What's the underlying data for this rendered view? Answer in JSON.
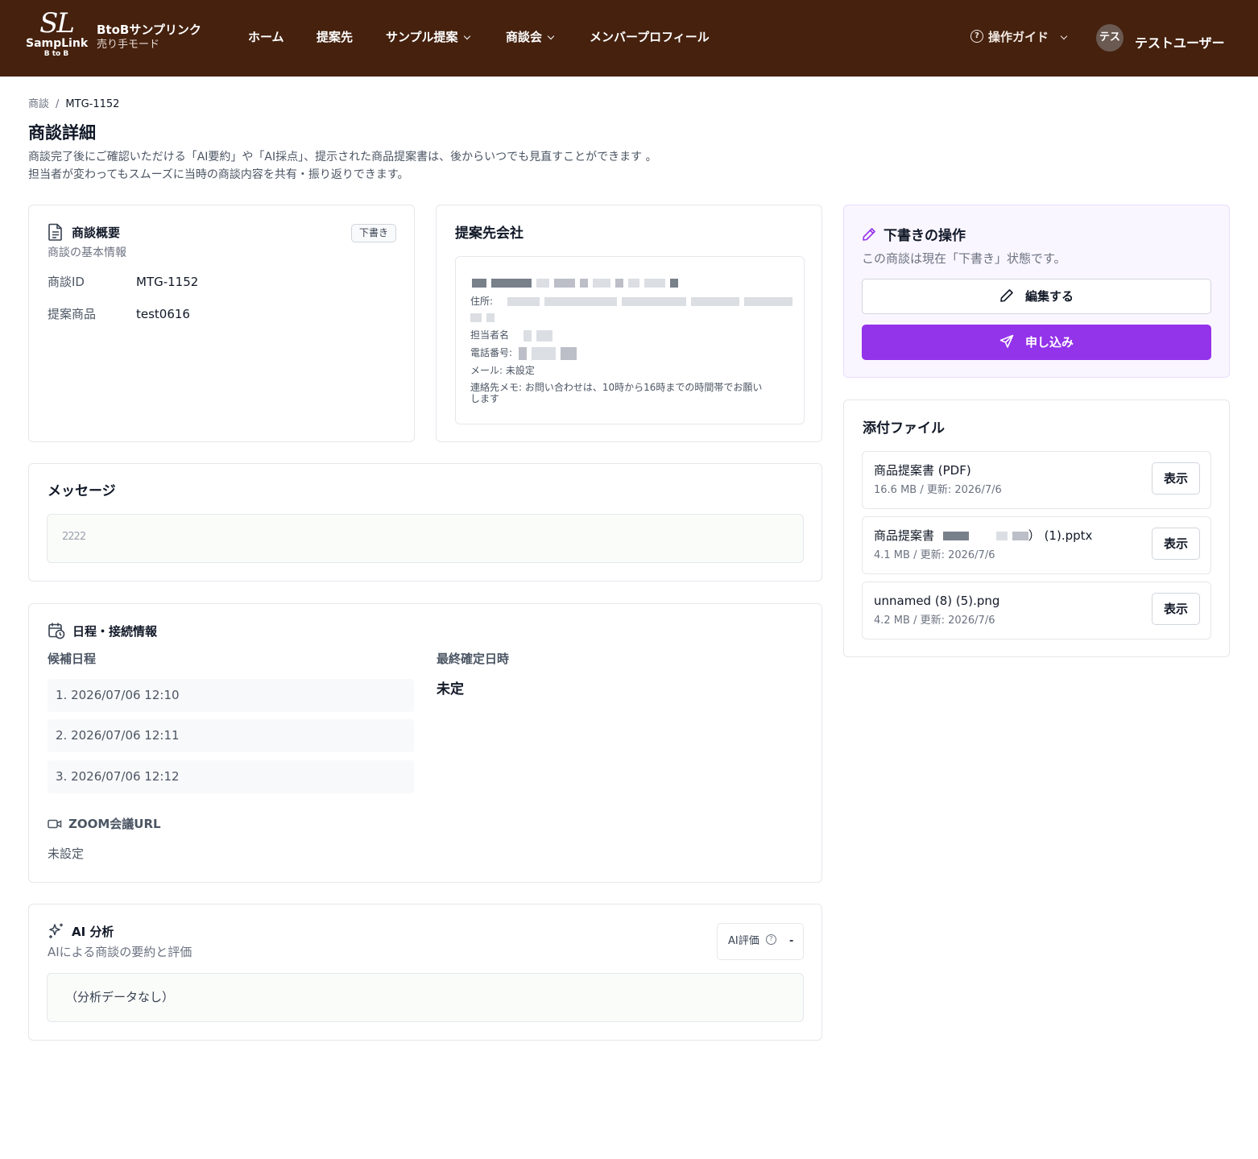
{
  "header": {
    "logo_mark": "SL",
    "logo_text": "SampLink",
    "logo_sub": "B to B",
    "brand_name": "BtoBサンプリンク",
    "brand_mode": "売り手モード",
    "nav": [
      "ホーム",
      "提案先",
      "サンプル提案",
      "商談会",
      "メンバープロフィール"
    ],
    "guide_label": "操作ガイド",
    "avatar_initials": "テス",
    "user_name": "テストユーザー"
  },
  "breadcrumb": {
    "parent": "商談",
    "separator": "/",
    "current": "MTG-1152"
  },
  "page": {
    "title": "商談詳細",
    "desc_line1": "商談完了後にご確認いただける「AI要約」や「AI採点」、提示された商品提案書は、後からいつでも見直すことができます 。",
    "desc_line2": "担当者が変わってもスムーズに当時の商談内容を共有・振り返りできます。"
  },
  "overview": {
    "title": "商談概要",
    "subtitle": "商談の基本情報",
    "badge": "下書き",
    "id_label": "商談ID",
    "id_value": "MTG-1152",
    "product_label": "提案商品",
    "product_value": "test0616"
  },
  "company": {
    "title": "提案先会社",
    "address_label": "住所:",
    "contact_label": "担当者名",
    "phone_label": "電話番号:",
    "email_line": "メール: 未設定",
    "memo_line1": "連絡先メモ: お問い合わせは、10時から16時までの時間帯でお願い",
    "memo_line2": "します"
  },
  "message": {
    "title": "メッセージ",
    "body": "2222"
  },
  "schedule": {
    "title": "日程・接続情報",
    "candidates_label": "候補日程",
    "candidates": [
      "1. 2026/07/06 12:10",
      "2. 2026/07/06 12:11",
      "3. 2026/07/06 12:12"
    ],
    "final_label": "最終確定日時",
    "final_value": "未定",
    "zoom_label": "ZOOM会議URL",
    "zoom_value": "未設定"
  },
  "ai": {
    "title": "AI 分析",
    "subtitle": "AIによる商談の要約と評価",
    "rating_label": "AI評価",
    "rating_value": "-",
    "empty": "（分析データなし）"
  },
  "draft": {
    "title": "下書きの操作",
    "status": "この商談は現在「下書き」状態です。",
    "edit_label": "編集する",
    "apply_label": "申し込み"
  },
  "files": {
    "title": "添付ファイル",
    "view_label": "表示",
    "items": [
      {
        "name": "商品提案書 (PDF)",
        "meta": "16.6 MB / 更新: 2026/7/6"
      },
      {
        "name_prefix": "商品提案書",
        "name_suffix": "） (1).pptx",
        "meta": "4.1 MB / 更新: 2026/7/6"
      },
      {
        "name": "unnamed (8) (5).png",
        "meta": "4.2 MB / 更新: 2026/7/6"
      }
    ]
  },
  "colors": {
    "header_bg": "#45210e",
    "accent": "#9333ea",
    "draft_bg": "#faf6ff"
  }
}
